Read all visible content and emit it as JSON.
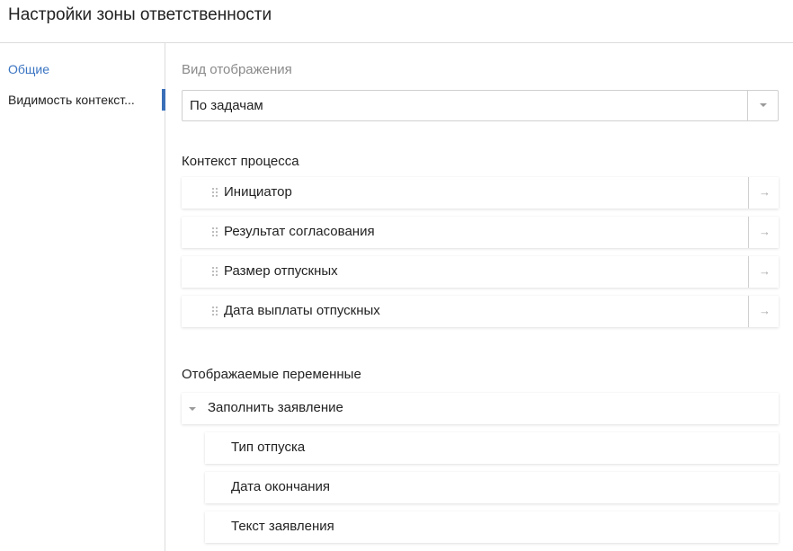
{
  "header": {
    "title": "Настройки зоны ответственности"
  },
  "sidebar": {
    "items": [
      {
        "label": "Общие"
      },
      {
        "label": "Видимость контекст..."
      }
    ]
  },
  "display": {
    "label": "Вид отображения",
    "selected": "По задачам"
  },
  "context": {
    "title": "Контекст процесса",
    "items": [
      {
        "label": "Инициатор"
      },
      {
        "label": "Результат согласования"
      },
      {
        "label": "Размер отпускных"
      },
      {
        "label": "Дата выплаты отпускных"
      }
    ]
  },
  "variables": {
    "title": "Отображаемые переменные",
    "groups": [
      {
        "label": "Заполнить заявление",
        "items": [
          {
            "label": "Тип отпуска"
          },
          {
            "label": "Дата окончания"
          },
          {
            "label": "Текст заявления"
          }
        ]
      }
    ]
  },
  "colors": {
    "accent": "#3a74c2",
    "indicator": "#3a6fb8"
  }
}
